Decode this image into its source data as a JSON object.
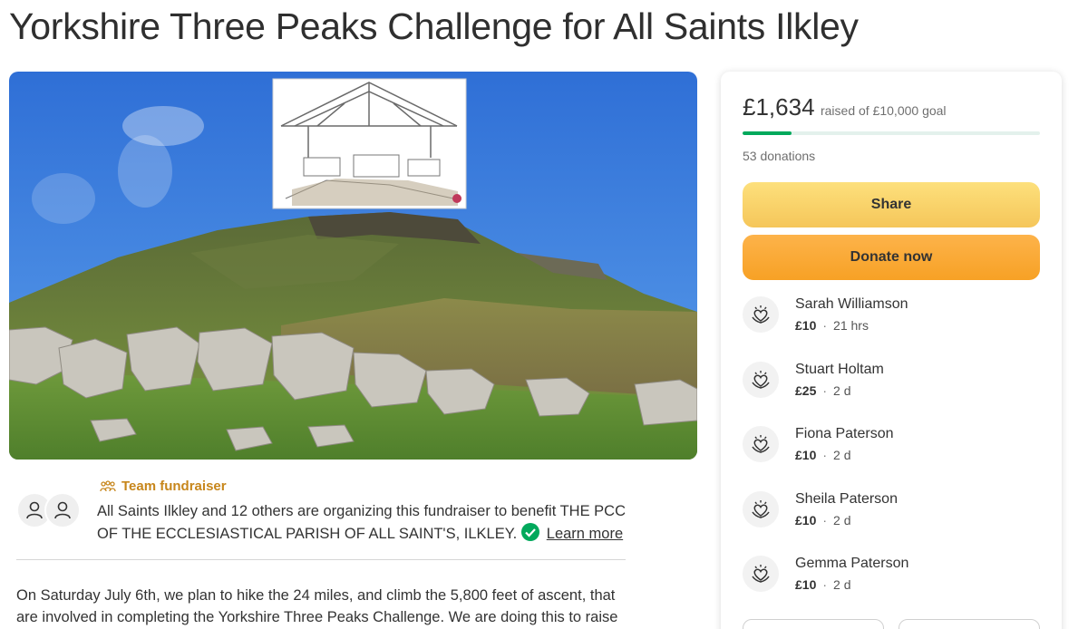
{
  "page": {
    "title": "Yorkshire Three Peaks Challenge for All Saints Ilkley"
  },
  "organizer": {
    "team_label": "Team fundraiser",
    "text": "All Saints Ilkley and 12 others are organizing this fundraiser to benefit THE PCC OF THE ECCLESIASTICAL PARISH OF ALL SAINT'S, ILKLEY.",
    "learn_more": "Learn more",
    "verified_color": "#02a95c",
    "team_color": "#c7861b"
  },
  "story": {
    "text": "On Saturday July 6th, we plan to hike the 24 miles, and climb the 5,800 feet of ascent, that are involved in completing the Yorkshire Three Peaks Challenge. We are doing this to raise"
  },
  "donation_card": {
    "raised_amount": "£1,634",
    "goal_text": "raised of £10,000 goal",
    "progress_fraction": 0.1634,
    "donations_count": "53 donations",
    "share_label": "Share",
    "donate_label": "Donate now",
    "progress_color": "#02a95c",
    "share_color": "#f7d36a",
    "donate_color": "#f9aa33",
    "donors": [
      {
        "name": "Sarah Williamson",
        "amount": "£10",
        "time": "21 hrs",
        "icon": "heart-hands-icon"
      },
      {
        "name": "Stuart Holtam",
        "amount": "£25",
        "time": "2 d",
        "icon": "heart-hands-icon"
      },
      {
        "name": "Fiona Paterson",
        "amount": "£10",
        "time": "2 d",
        "icon": "heart-hands-icon"
      },
      {
        "name": "Sheila Paterson",
        "amount": "£10",
        "time": "2 d",
        "icon": "heart-hands-icon"
      },
      {
        "name": "Gemma Paterson",
        "amount": "£10",
        "time": "2 d",
        "icon": "heart-hands-icon"
      }
    ]
  }
}
